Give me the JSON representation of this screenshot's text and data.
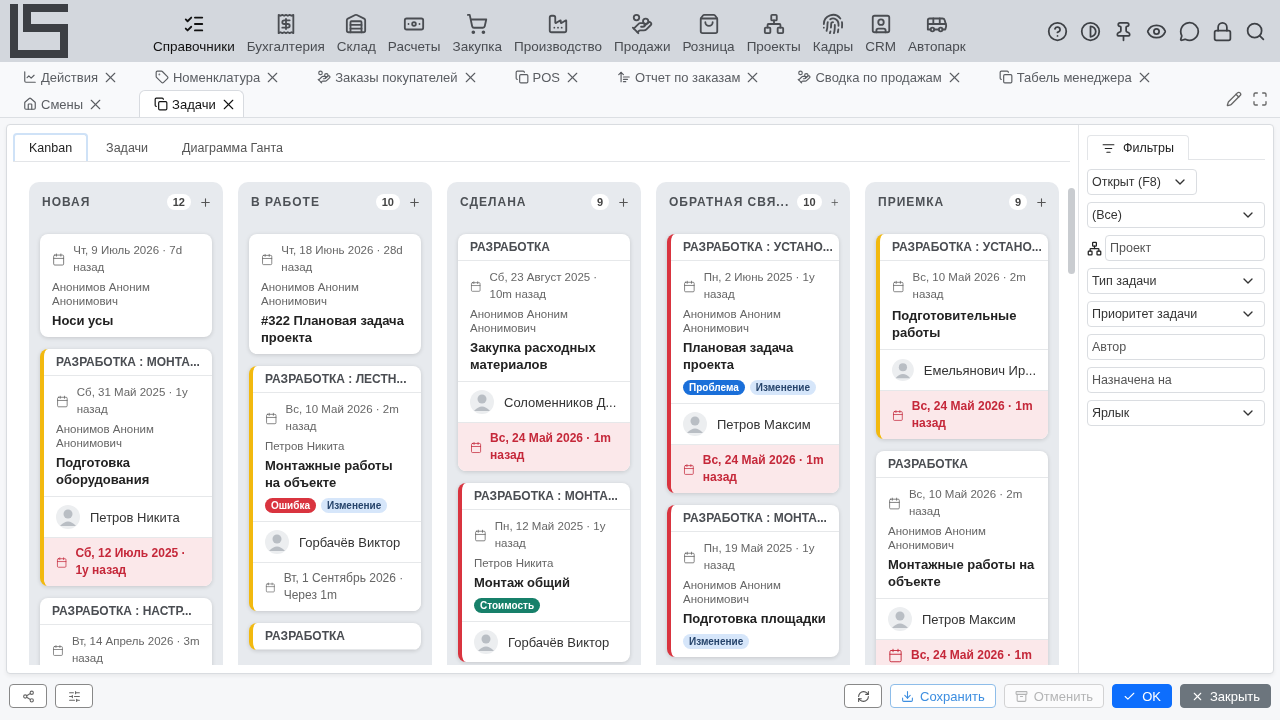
{
  "nav": {
    "items": [
      {
        "label": "Справочники",
        "selected": true
      },
      {
        "label": "Бухгалтерия",
        "selected": false
      },
      {
        "label": "Склад",
        "selected": false
      },
      {
        "label": "Расчеты",
        "selected": false
      },
      {
        "label": "Закупка",
        "selected": false
      },
      {
        "label": "Производство",
        "selected": false
      },
      {
        "label": "Продажи",
        "selected": false
      },
      {
        "label": "Розница",
        "selected": false
      },
      {
        "label": "Проекты",
        "selected": false
      },
      {
        "label": "Кадры",
        "selected": false
      },
      {
        "label": "CRM",
        "selected": false
      },
      {
        "label": "Автопарк",
        "selected": false
      }
    ]
  },
  "tabs": [
    {
      "label": "Действия",
      "selected": false
    },
    {
      "label": "Номенклатура",
      "selected": false
    },
    {
      "label": "Заказы покупателей",
      "selected": false
    },
    {
      "label": "POS",
      "selected": false
    },
    {
      "label": "Отчет по заказам",
      "selected": false
    },
    {
      "label": "Сводка по продажам",
      "selected": false
    },
    {
      "label": "Табель менеджера",
      "selected": false
    },
    {
      "label": "Смены",
      "selected": false
    },
    {
      "label": "Задачи",
      "selected": true
    }
  ],
  "view_tabs": [
    {
      "label": "Kanban",
      "selected": true
    },
    {
      "label": "Задачи",
      "selected": false
    },
    {
      "label": "Диаграмма Ганта",
      "selected": false
    }
  ],
  "columns": [
    {
      "title": "НОВАЯ",
      "count": "12",
      "cards": [
        {
          "date": "Чт, 9 Июль 2026 · 7d назад",
          "author": "Анонимов Аноним Анонимович",
          "title": "Носи усы"
        },
        {
          "color": "#f2b90f",
          "header": "РАЗРАБОТКА : МОНТА...",
          "date": "Сб, 31 Май 2025 · 1y назад",
          "author": "Анонимов Аноним Анонимович",
          "title": "Подготовка оборудования",
          "assignee": "Петров Никита",
          "due": {
            "text": "Сб, 12 Июль 2025 · 1y назад",
            "overdue": true
          }
        },
        {
          "header": "РАЗРАБОТКА : НАСТР...",
          "date": "Вт, 14 Апрель 2026 · 3m назад"
        }
      ]
    },
    {
      "title": "В РАБОТЕ",
      "count": "10",
      "cards": [
        {
          "date": "Чт, 18 Июнь 2026 · 28d назад",
          "author": "Анонимов Аноним Анонимович",
          "title": "#322 Плановая задача проекта"
        },
        {
          "color": "#f2b90f",
          "header": "РАЗРАБОТКА : ЛЕСТН...",
          "date": "Вс, 10 Май 2026 · 2m назад",
          "author": "Петров Никита",
          "title": "Монтажные работы на объекте",
          "tags": [
            {
              "label": "Ошибка",
              "kind": "danger"
            },
            {
              "label": "Изменение",
              "kind": "info"
            }
          ],
          "assignee": "Горбачёв Виктор",
          "due": {
            "text": "Вт, 1 Сентябрь 2026 · Через 1m",
            "overdue": false
          }
        },
        {
          "color": "#f2b90f",
          "header": "РАЗРАБОТКА"
        }
      ]
    },
    {
      "title": "СДЕЛАНА",
      "count": "9",
      "cards": [
        {
          "header": "РАЗРАБОТКА",
          "date": "Сб, 23 Август 2025 · 10m назад",
          "author": "Анонимов Аноним Анонимович",
          "title": "Закупка расходных материалов",
          "assignee": "Соломенников Д...",
          "due": {
            "text": "Вс, 24 Май 2026 · 1m назад",
            "overdue": true
          }
        },
        {
          "color": "#d9343f",
          "header": "РАЗРАБОТКА : МОНТА...",
          "date": "Пн, 12 Май 2025 · 1y назад",
          "author": "Петров Никита",
          "title": "Монтаж общий",
          "tags": [
            {
              "label": "Стоимость",
              "kind": "success"
            }
          ],
          "assignee": "Горбачёв Виктор"
        }
      ]
    },
    {
      "title": "ОБРАТНАЯ СВЯ...",
      "count": "10",
      "cards": [
        {
          "color": "#d9343f",
          "header": "РАЗРАБОТКА : УСТАНО...",
          "date": "Пн, 2 Июнь 2025 · 1y назад",
          "author": "Анонимов Аноним Анонимович",
          "title": "Плановая задача проекта",
          "tags": [
            {
              "label": "Проблема",
              "kind": "primary"
            },
            {
              "label": "Изменение",
              "kind": "info"
            }
          ],
          "assignee": "Петров Максим",
          "due": {
            "text": "Вс, 24 Май 2026 · 1m назад",
            "overdue": true
          }
        },
        {
          "color": "#d9343f",
          "header": "РАЗРАБОТКА : МОНТА...",
          "date": "Пн, 19 Май 2025 · 1y назад",
          "author": "Анонимов Аноним Анонимович",
          "title": "Подготовка площадки",
          "tags": [
            {
              "label": "Изменение",
              "kind": "info"
            }
          ]
        }
      ]
    },
    {
      "title": "ПРИЕМКА",
      "count": "9",
      "cards": [
        {
          "color": "#f2b90f",
          "header": "РАЗРАБОТКА : УСТАНО...",
          "date": "Вс, 10 Май 2026 · 2m назад",
          "title": "Подготовительные работы",
          "assignee": "Емельянович Ир...",
          "due": {
            "text": "Вс, 24 Май 2026 · 1m назад",
            "overdue": true
          }
        },
        {
          "header": "РАЗРАБОТКА",
          "date": "Вс, 10 Май 2026 · 2m назад",
          "author": "Анонимов Аноним Анонимович",
          "title": "Монтажные работы на объекте",
          "assignee": "Петров Максим",
          "due": {
            "text": "Вс, 24 Май 2026 · 1m",
            "overdue": true
          }
        }
      ]
    }
  ],
  "filters": {
    "tab": "Фильтры",
    "fields": [
      {
        "kind": "select",
        "value": "Открыт (F8)"
      },
      {
        "kind": "select",
        "value": "(Все)"
      },
      {
        "kind": "input",
        "placeholder": "Проект"
      },
      {
        "kind": "select",
        "value": "Тип задачи"
      },
      {
        "kind": "select",
        "value": "Приоритет задачи"
      },
      {
        "kind": "input",
        "placeholder": "Автор"
      },
      {
        "kind": "input",
        "placeholder": "Назначена на"
      },
      {
        "kind": "select",
        "value": "Ярлык"
      }
    ]
  },
  "footer": {
    "left": [
      {
        "kind": "share"
      },
      {
        "kind": "settings"
      }
    ],
    "right": [
      {
        "kind": "refresh"
      },
      {
        "kind": "save",
        "label": "Сохранить",
        "disabled": false
      },
      {
        "kind": "cancel",
        "label": "Отменить",
        "disabled": true
      },
      {
        "kind": "ok",
        "label": "OK",
        "disabled": false
      },
      {
        "kind": "close",
        "label": "Закрыть",
        "disabled": false
      }
    ]
  }
}
